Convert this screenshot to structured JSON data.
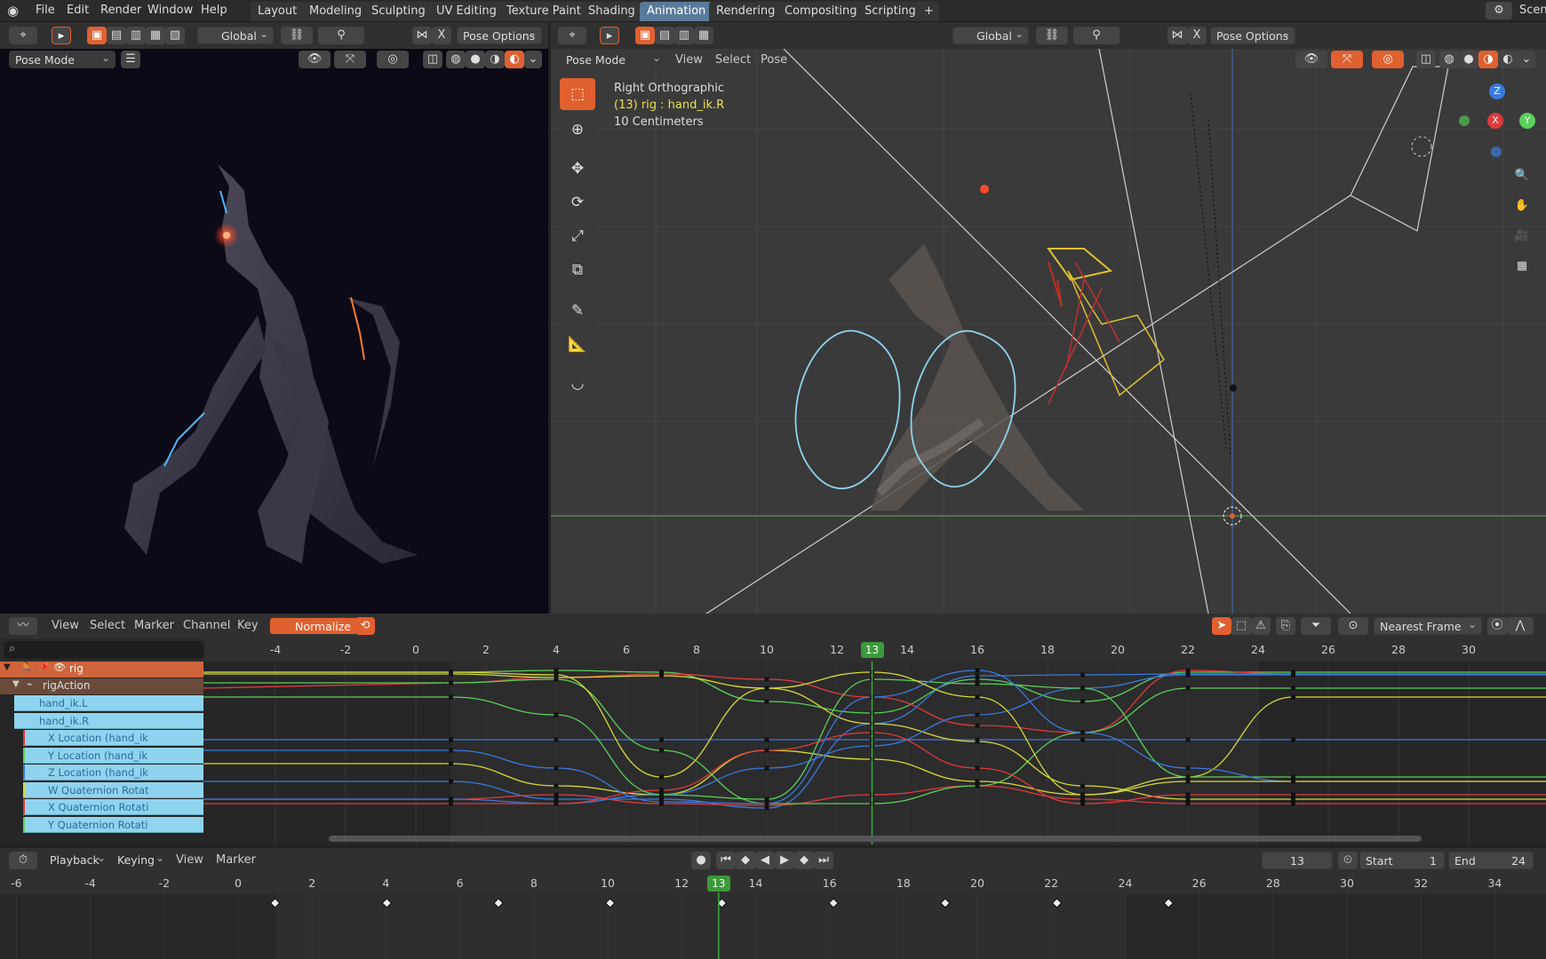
{
  "topbar": {
    "menus": [
      "File",
      "Edit",
      "Render",
      "Window",
      "Help"
    ],
    "workspaces": [
      "Layout",
      "Modeling",
      "Sculpting",
      "UV Editing",
      "Texture Paint",
      "Shading",
      "Animation",
      "Rendering",
      "Compositing",
      "Scripting"
    ],
    "active_workspace": "Animation",
    "scene_label": "Scen"
  },
  "left_view": {
    "orientation": "Global",
    "pose_options": "Pose Options",
    "mode": "Pose Mode"
  },
  "right_view": {
    "orientation": "Global",
    "pose_options": "Pose Options",
    "mode": "Pose Mode",
    "menus": [
      "View",
      "Select",
      "Pose"
    ],
    "overlay_title": "Right Orthographic",
    "overlay_object": "(13) rig : hand_ik.R",
    "overlay_scale": "10 Centimeters",
    "gizmo": {
      "z": "Z",
      "x": "X",
      "y": "Y"
    }
  },
  "graph_editor": {
    "menus": [
      "View",
      "Select",
      "Marker",
      "Channel",
      "Key"
    ],
    "normalize": "Normalize",
    "snap": "Nearest Frame",
    "ticks": [
      "-4",
      "-2",
      "0",
      "2",
      "4",
      "6",
      "8",
      "10",
      "12",
      "13",
      "14",
      "16",
      "18",
      "20",
      "22",
      "24",
      "26",
      "28",
      "30"
    ],
    "current_frame": "13",
    "channels": {
      "rig": "rig",
      "action": "rigAction",
      "items": [
        {
          "label": "hand_ik.L",
          "color": "#8fd3ef"
        },
        {
          "label": "hand_ik.R",
          "color": "#8fd3ef"
        },
        {
          "label": "X Location (hand_ik",
          "color": "#e03a3a"
        },
        {
          "label": "Y Location (hand_ik",
          "color": "#5ad05a"
        },
        {
          "label": "Z Location (hand_ik",
          "color": "#3a7ae0"
        },
        {
          "label": "W Quaternion Rotat",
          "color": "#d8d83a"
        },
        {
          "label": "X Quaternion Rotati",
          "color": "#e03a3a"
        },
        {
          "label": "Y Quaternion Rotati",
          "color": "#5ad05a"
        }
      ]
    }
  },
  "timeline": {
    "menus": [
      "Playback",
      "Keying",
      "View",
      "Marker"
    ],
    "current_frame": "13",
    "start_label": "Start",
    "start": "1",
    "end_label": "End",
    "end": "24",
    "ticks": [
      "-6",
      "-4",
      "-2",
      "0",
      "2",
      "4",
      "6",
      "8",
      "10",
      "12",
      "13",
      "14",
      "16",
      "18",
      "20",
      "22",
      "24",
      "26",
      "28",
      "30",
      "32",
      "34"
    ]
  },
  "colors": {
    "accent": "#e06030",
    "active_tab": "#5a7a9a",
    "frame": "#3a9a3a",
    "channel": "#8fd3ef"
  }
}
